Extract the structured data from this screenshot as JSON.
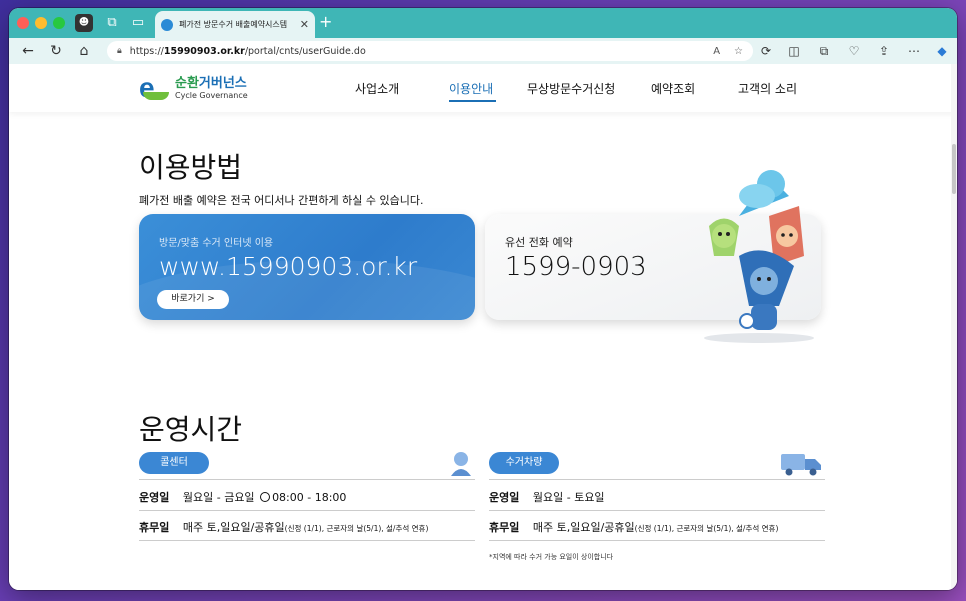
{
  "browser": {
    "tab_title": "폐가전 방문수거 배출예약시스템",
    "url_prefix": "https://",
    "url_host": "15990903.or.kr",
    "url_path": "/portal/cnts/userGuide.do"
  },
  "header": {
    "logo_kr_a": "순환",
    "logo_kr_b": "거버넌스",
    "logo_en": "Cycle Governance",
    "menu": [
      "사업소개",
      "이용안내",
      "무상방문수거신청",
      "예약조회",
      "고객의 소리"
    ],
    "active_index": 1
  },
  "usage": {
    "title": "이용방법",
    "subtitle": "폐가전 배출 예약은 전국 어디서나 간편하게 하실 수 있습니다.",
    "online": {
      "label": "방문/맞춤 수거 인터넷 이용",
      "url": "www.15990903.or.kr",
      "button": "바로가기 >"
    },
    "phone": {
      "label": "유선 전화 예약",
      "number": "1599-0903"
    }
  },
  "hours": {
    "title": "운영시간",
    "call_center": {
      "pill": "콜센터",
      "open_key": "운영일",
      "open_value": "월요일 - 금요일",
      "open_time": "08:00 - 18:00",
      "closed_key": "휴무일",
      "closed_value": "매주 토,일요일/공휴일",
      "closed_note": "(신정 (1/1), 근로자의 날(5/1), 설/추석 연휴)"
    },
    "truck": {
      "pill": "수거차량",
      "open_key": "운영일",
      "open_value": "월요일 - 토요일",
      "closed_key": "휴무일",
      "closed_value": "매주 토,일요일/공휴일",
      "closed_note": "(신정 (1/1), 근로자의 날(5/1), 설/추석 연휴)",
      "note": "*지역에 따라 수거 가능 요일이 상이합니다"
    }
  }
}
